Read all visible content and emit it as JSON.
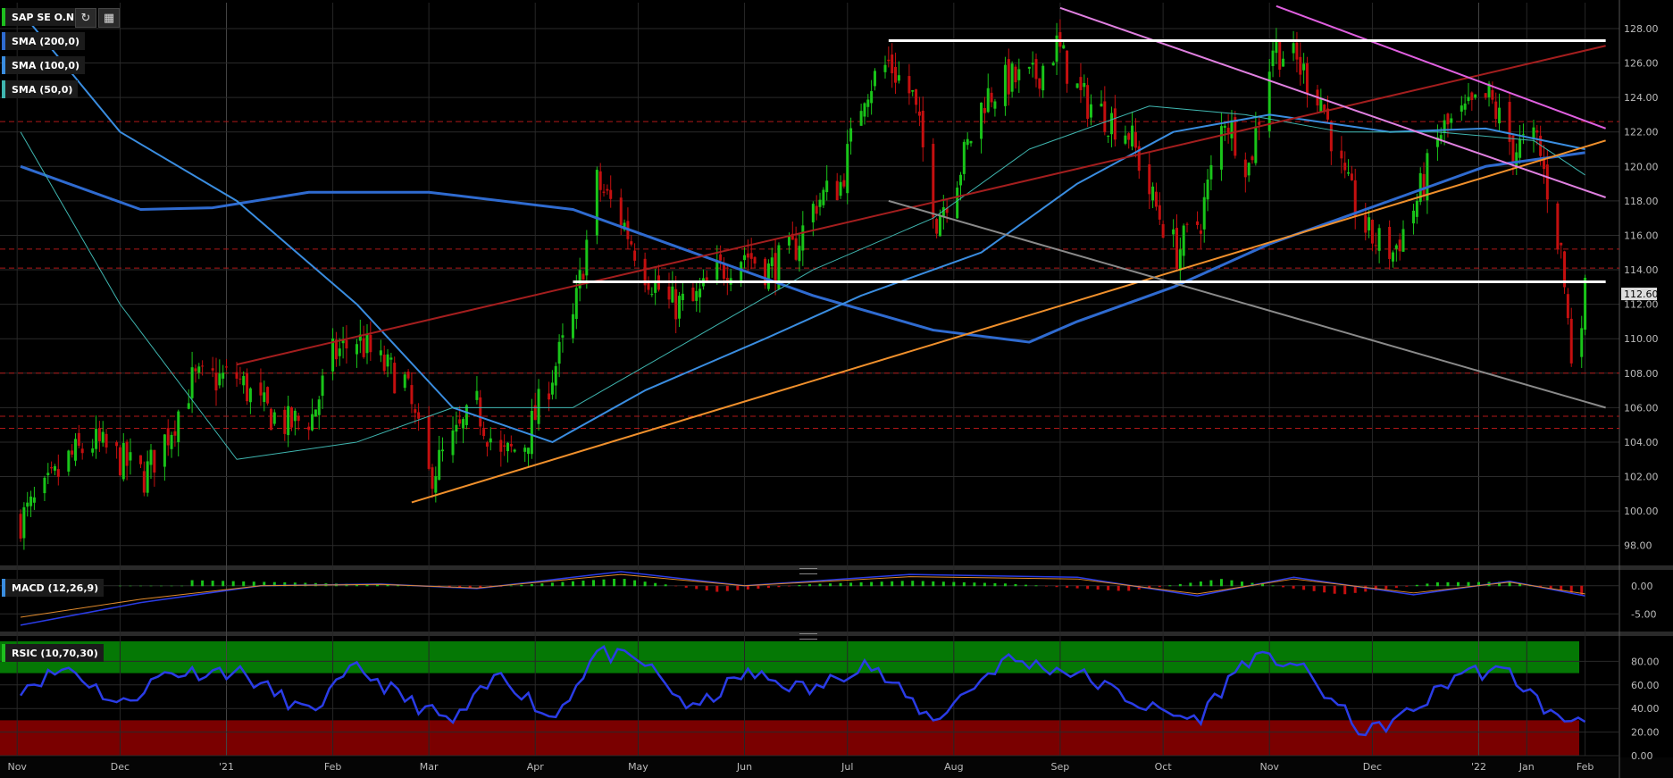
{
  "symbol": "SAP SE O.N.",
  "legend": {
    "sma200": "SMA (200,0)",
    "sma100": "SMA (100,0)",
    "sma50": "SMA (50,0)",
    "macd": "MACD (12,26,9)",
    "rsi": "RSIC (10,70,30)"
  },
  "icons": [
    "refresh-icon",
    "chart-settings-icon"
  ],
  "colors": {
    "up": "#19c419",
    "down": "#c40f0f",
    "sma200": "#2f6bd0",
    "sma100": "#3a8de0",
    "sma50": "#3fb6b0",
    "trend_orange": "#f0902c",
    "trend_pink": "#e060e0",
    "trend_grey": "#8a8a8a",
    "trend_red": "#a41e1e",
    "resistance": "#ffffff",
    "rsi_over": "#057805",
    "rsi_under": "#7a0000",
    "rsi_line": "#2a3ce6"
  },
  "chart_data": [
    {
      "type": "candlestick",
      "title": "SAP SE O.N.",
      "ylim": [
        97,
        129.5
      ],
      "y_ticks": [
        "128.00",
        "126.00",
        "124.00",
        "122.00",
        "120.00",
        "118.00",
        "116.00",
        "114.00",
        "112.00",
        "110.00",
        "108.00",
        "106.00",
        "104.00",
        "102.00",
        "100.00",
        "98.00"
      ],
      "last_price": "112.60",
      "x_ticks": [
        "Nov",
        "Dec",
        "'21",
        "Feb",
        "Mar",
        "Apr",
        "May",
        "Jun",
        "Jul",
        "Aug",
        "Sep",
        "Oct",
        "Nov",
        "Dec",
        "'22",
        "Jan",
        "Feb"
      ],
      "close_path": [
        {
          "d": "2020-11-02",
          "v": 99.5
        },
        {
          "d": "2020-11-09",
          "v": 101
        },
        {
          "d": "2020-11-16",
          "v": 103
        },
        {
          "d": "2020-11-23",
          "v": 104
        },
        {
          "d": "2020-12-01",
          "v": 103
        },
        {
          "d": "2020-12-08",
          "v": 102
        },
        {
          "d": "2020-12-15",
          "v": 104.5
        },
        {
          "d": "2020-12-22",
          "v": 107.5
        },
        {
          "d": "2021-01-04",
          "v": 107.8
        },
        {
          "d": "2021-01-11",
          "v": 106
        },
        {
          "d": "2021-01-19",
          "v": 105
        },
        {
          "d": "2021-01-26",
          "v": 105.5
        },
        {
          "d": "2021-02-01",
          "v": 109
        },
        {
          "d": "2021-02-08",
          "v": 110
        },
        {
          "d": "2021-02-15",
          "v": 108.5
        },
        {
          "d": "2021-02-22",
          "v": 107.5
        },
        {
          "d": "2021-03-01",
          "v": 102
        },
        {
          "d": "2021-03-08",
          "v": 104
        },
        {
          "d": "2021-03-15",
          "v": 106
        },
        {
          "d": "2021-03-22",
          "v": 103
        },
        {
          "d": "2021-03-29",
          "v": 104
        },
        {
          "d": "2021-04-06",
          "v": 108
        },
        {
          "d": "2021-04-12",
          "v": 111
        },
        {
          "d": "2021-04-19",
          "v": 119
        },
        {
          "d": "2021-04-26",
          "v": 117
        },
        {
          "d": "2021-05-03",
          "v": 114
        },
        {
          "d": "2021-05-10",
          "v": 112
        },
        {
          "d": "2021-05-17",
          "v": 112
        },
        {
          "d": "2021-05-25",
          "v": 114
        },
        {
          "d": "2021-06-01",
          "v": 115
        },
        {
          "d": "2021-06-08",
          "v": 114
        },
        {
          "d": "2021-06-15",
          "v": 115
        },
        {
          "d": "2021-06-22",
          "v": 118
        },
        {
          "d": "2021-06-29",
          "v": 119
        },
        {
          "d": "2021-07-06",
          "v": 124.5
        },
        {
          "d": "2021-07-13",
          "v": 126
        },
        {
          "d": "2021-07-20",
          "v": 124
        },
        {
          "d": "2021-07-27",
          "v": 117
        },
        {
          "d": "2021-08-03",
          "v": 120
        },
        {
          "d": "2021-08-10",
          "v": 124
        },
        {
          "d": "2021-08-17",
          "v": 125
        },
        {
          "d": "2021-08-24",
          "v": 125
        },
        {
          "d": "2021-08-31",
          "v": 127
        },
        {
          "d": "2021-09-07",
          "v": 124
        },
        {
          "d": "2021-09-14",
          "v": 123
        },
        {
          "d": "2021-09-21",
          "v": 122
        },
        {
          "d": "2021-09-28",
          "v": 118
        },
        {
          "d": "2021-10-05",
          "v": 115
        },
        {
          "d": "2021-10-12",
          "v": 117
        },
        {
          "d": "2021-10-19",
          "v": 123
        },
        {
          "d": "2021-10-26",
          "v": 120
        },
        {
          "d": "2021-11-02",
          "v": 127
        },
        {
          "d": "2021-11-09",
          "v": 126
        },
        {
          "d": "2021-11-16",
          "v": 124
        },
        {
          "d": "2021-11-23",
          "v": 119
        },
        {
          "d": "2021-11-30",
          "v": 116
        },
        {
          "d": "2021-12-07",
          "v": 115
        },
        {
          "d": "2021-12-14",
          "v": 118
        },
        {
          "d": "2021-12-21",
          "v": 122
        },
        {
          "d": "2021-12-28",
          "v": 123
        },
        {
          "d": "2022-01-04",
          "v": 124
        },
        {
          "d": "2022-01-11",
          "v": 121
        },
        {
          "d": "2022-01-18",
          "v": 121.5
        },
        {
          "d": "2022-01-25",
          "v": 115
        },
        {
          "d": "2022-01-28",
          "v": 109
        },
        {
          "d": "2022-02-01",
          "v": 112.6
        }
      ],
      "sma50": [
        {
          "d": "2020-11-02",
          "v": 122
        },
        {
          "d": "2020-12-01",
          "v": 112
        },
        {
          "d": "2021-01-04",
          "v": 103
        },
        {
          "d": "2021-02-08",
          "v": 104
        },
        {
          "d": "2021-03-08",
          "v": 106
        },
        {
          "d": "2021-04-12",
          "v": 106
        },
        {
          "d": "2021-05-17",
          "v": 110
        },
        {
          "d": "2021-06-21",
          "v": 114
        },
        {
          "d": "2021-07-26",
          "v": 117
        },
        {
          "d": "2021-08-23",
          "v": 121
        },
        {
          "d": "2021-09-27",
          "v": 123.5
        },
        {
          "d": "2021-10-25",
          "v": 123
        },
        {
          "d": "2021-11-22",
          "v": 122
        },
        {
          "d": "2021-12-20",
          "v": 122
        },
        {
          "d": "2022-01-17",
          "v": 121.5
        },
        {
          "d": "2022-02-01",
          "v": 119.5
        }
      ],
      "sma100": [
        {
          "d": "2020-11-02",
          "v": 129
        },
        {
          "d": "2020-12-01",
          "v": 122
        },
        {
          "d": "2021-01-04",
          "v": 118
        },
        {
          "d": "2021-02-08",
          "v": 112
        },
        {
          "d": "2021-03-08",
          "v": 106
        },
        {
          "d": "2021-04-06",
          "v": 104
        },
        {
          "d": "2021-05-03",
          "v": 107
        },
        {
          "d": "2021-06-07",
          "v": 110
        },
        {
          "d": "2021-07-05",
          "v": 112.5
        },
        {
          "d": "2021-08-09",
          "v": 115
        },
        {
          "d": "2021-09-06",
          "v": 119
        },
        {
          "d": "2021-10-04",
          "v": 122
        },
        {
          "d": "2021-11-01",
          "v": 123
        },
        {
          "d": "2021-12-06",
          "v": 122
        },
        {
          "d": "2022-01-03",
          "v": 122.2
        },
        {
          "d": "2022-02-01",
          "v": 121
        }
      ],
      "sma200": [
        {
          "d": "2020-11-02",
          "v": 120
        },
        {
          "d": "2020-12-07",
          "v": 117.5
        },
        {
          "d": "2020-12-28",
          "v": 117.6
        },
        {
          "d": "2021-01-25",
          "v": 118.5
        },
        {
          "d": "2021-03-01",
          "v": 118.5
        },
        {
          "d": "2021-04-12",
          "v": 117.5
        },
        {
          "d": "2021-05-17",
          "v": 115
        },
        {
          "d": "2021-06-21",
          "v": 112.5
        },
        {
          "d": "2021-07-26",
          "v": 110.5
        },
        {
          "d": "2021-08-23",
          "v": 109.8
        },
        {
          "d": "2021-09-06",
          "v": 111
        },
        {
          "d": "2021-10-04",
          "v": 113
        },
        {
          "d": "2021-11-01",
          "v": 115.5
        },
        {
          "d": "2021-12-06",
          "v": 118
        },
        {
          "d": "2022-01-03",
          "v": 120
        },
        {
          "d": "2022-02-01",
          "v": 120.8
        }
      ],
      "trendlines": [
        {
          "name": "orange-support",
          "color": "#f0902c",
          "from": {
            "d": "2021-02-24",
            "v": 100.5
          },
          "to": {
            "d": "2022-02-07",
            "v": 121.5
          }
        },
        {
          "name": "red-trend",
          "color": "#a41e1e",
          "from": {
            "d": "2021-01-04",
            "v": 108.5
          },
          "to": {
            "d": "2022-02-07",
            "v": 127
          }
        },
        {
          "name": "grey-trend",
          "color": "#8a8a8a",
          "from": {
            "d": "2021-07-13",
            "v": 118
          },
          "to": {
            "d": "2022-02-07",
            "v": 106
          }
        },
        {
          "name": "pink-trend-upper",
          "color": "#e060e0",
          "from": {
            "d": "2021-11-03",
            "v": 129.3
          },
          "to": {
            "d": "2022-02-07",
            "v": 122.2
          }
        },
        {
          "name": "pink-trend-lower",
          "color": "#e080e0",
          "from": {
            "d": "2021-09-01",
            "v": 129.2
          },
          "to": {
            "d": "2022-02-07",
            "v": 118.2
          }
        },
        {
          "name": "resistance-top",
          "color": "#ffffff",
          "from": {
            "d": "2021-07-13",
            "v": 127.3
          },
          "to": {
            "d": "2022-02-07",
            "v": 127.3
          }
        },
        {
          "name": "support-middle",
          "color": "#ffffff",
          "from": {
            "d": "2021-04-12",
            "v": 113.3
          },
          "to": {
            "d": "2022-02-07",
            "v": 113.3
          }
        }
      ],
      "dashed_levels": [
        122.6,
        115.2,
        114.1,
        108.0,
        105.5,
        104.8
      ],
      "grid": true
    },
    {
      "type": "bar",
      "title": "MACD (12,26,9)",
      "y_ticks": [
        "0.00",
        "-5.00"
      ],
      "ylim": [
        -7.5,
        2.5
      ],
      "histogram": [
        {
          "d": "2020-12-21",
          "v": 1.0
        },
        {
          "d": "2021-01-18",
          "v": 0.6
        },
        {
          "d": "2021-02-15",
          "v": 0.2
        },
        {
          "d": "2021-03-15",
          "v": -0.4
        },
        {
          "d": "2021-04-12",
          "v": 0.8
        },
        {
          "d": "2021-04-26",
          "v": 1.3
        },
        {
          "d": "2021-05-24",
          "v": -1.0
        },
        {
          "d": "2021-06-21",
          "v": 0.3
        },
        {
          "d": "2021-07-19",
          "v": 0.9
        },
        {
          "d": "2021-08-16",
          "v": 0.4
        },
        {
          "d": "2021-09-20",
          "v": -0.9
        },
        {
          "d": "2021-10-18",
          "v": 1.2
        },
        {
          "d": "2021-11-22",
          "v": -1.5
        },
        {
          "d": "2021-12-20",
          "v": 0.6
        },
        {
          "d": "2022-01-10",
          "v": 0.7
        },
        {
          "d": "2022-01-31",
          "v": -1.6
        }
      ],
      "macd_line": [
        {
          "d": "2020-11-02",
          "v": -7
        },
        {
          "d": "2020-12-07",
          "v": -3
        },
        {
          "d": "2021-01-11",
          "v": 0
        },
        {
          "d": "2021-02-15",
          "v": 0.3
        },
        {
          "d": "2021-03-15",
          "v": -0.5
        },
        {
          "d": "2021-04-26",
          "v": 2.5
        },
        {
          "d": "2021-06-01",
          "v": 0
        },
        {
          "d": "2021-07-19",
          "v": 2.0
        },
        {
          "d": "2021-09-06",
          "v": 1.5
        },
        {
          "d": "2021-10-11",
          "v": -1.8
        },
        {
          "d": "2021-11-08",
          "v": 1.5
        },
        {
          "d": "2021-12-13",
          "v": -1.6
        },
        {
          "d": "2022-01-10",
          "v": 0.8
        },
        {
          "d": "2022-02-01",
          "v": -1.8
        }
      ]
    },
    {
      "type": "line",
      "title": "RSIC (10,70,30)",
      "y_ticks": [
        "80.00",
        "60.00",
        "40.00",
        "20.00",
        "0.00"
      ],
      "ylim": [
        0,
        100
      ],
      "overbought": 70,
      "oversold": 30,
      "series": [
        {
          "values": [
            {
              "d": "2020-11-02",
              "v": 58
            },
            {
              "d": "2020-11-16",
              "v": 75
            },
            {
              "d": "2020-12-01",
              "v": 42
            },
            {
              "d": "2020-12-14",
              "v": 70
            },
            {
              "d": "2021-01-04",
              "v": 72
            },
            {
              "d": "2021-01-25",
              "v": 36
            },
            {
              "d": "2021-02-08",
              "v": 75
            },
            {
              "d": "2021-02-22",
              "v": 48
            },
            {
              "d": "2021-03-08",
              "v": 28
            },
            {
              "d": "2021-03-22",
              "v": 70
            },
            {
              "d": "2021-04-06",
              "v": 30
            },
            {
              "d": "2021-04-19",
              "v": 88
            },
            {
              "d": "2021-05-03",
              "v": 78
            },
            {
              "d": "2021-05-17",
              "v": 38
            },
            {
              "d": "2021-06-01",
              "v": 70
            },
            {
              "d": "2021-06-21",
              "v": 55
            },
            {
              "d": "2021-07-06",
              "v": 80
            },
            {
              "d": "2021-07-26",
              "v": 30
            },
            {
              "d": "2021-08-16",
              "v": 82
            },
            {
              "d": "2021-09-06",
              "v": 70
            },
            {
              "d": "2021-09-27",
              "v": 40
            },
            {
              "d": "2021-10-11",
              "v": 30
            },
            {
              "d": "2021-10-25",
              "v": 82
            },
            {
              "d": "2021-11-08",
              "v": 80
            },
            {
              "d": "2021-11-29",
              "v": 18
            },
            {
              "d": "2021-12-13",
              "v": 38
            },
            {
              "d": "2021-12-27",
              "v": 72
            },
            {
              "d": "2022-01-10",
              "v": 70
            },
            {
              "d": "2022-01-24",
              "v": 30
            },
            {
              "d": "2022-02-01",
              "v": 33
            }
          ]
        }
      ],
      "x_ticks": [
        "Nov",
        "Dec",
        "'21",
        "Feb",
        "Mar",
        "Apr",
        "May",
        "Jun",
        "Jul",
        "Aug",
        "Sep",
        "Oct",
        "Nov",
        "Dec",
        "'22",
        "Feb"
      ]
    }
  ]
}
